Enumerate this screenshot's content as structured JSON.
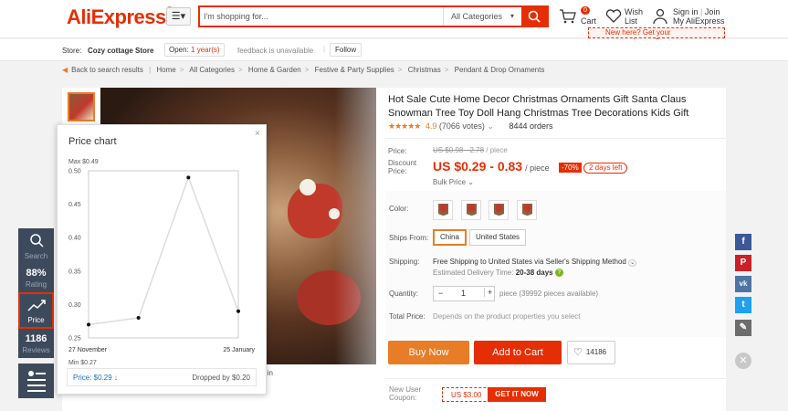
{
  "header": {
    "logo": "AliExpress",
    "logo_tm": "®",
    "search_placeholder": "I'm shopping for...",
    "search_category": "All Categories",
    "cart_count": "0",
    "cart_label": "Cart",
    "wish_label_1": "Wish",
    "wish_label_2": "List",
    "signin": "Sign in",
    "join": "Join",
    "my_aliexpress": "My AliExpress",
    "coupon_banner": "New here? Get your coupons!",
    "coupon_banner_amt": "$"
  },
  "store": {
    "label": "Store:",
    "name": "Cozy cottage Store",
    "open_label": "Open:",
    "open_value": "1 year(s)",
    "feedback": "feedback is unavailable",
    "follow": "Follow"
  },
  "breadcrumb": {
    "back": "Back to search results",
    "items": [
      "Home",
      "All Categories",
      "Home & Garden",
      "Festive & Party Supplies",
      "Christmas",
      "Pendant & Drop Ornaments"
    ]
  },
  "product": {
    "title": "Hot Sale Cute Home Decor Christmas Ornaments Gift Santa Claus Snowman Tree Toy Doll Hang Christmas Tree Decorations Kids Gift",
    "stars": "★★★★★",
    "rating": "4.9",
    "votes": "(7066 votes)",
    "orders": "8444 orders",
    "price_label": "Price:",
    "old_price": "US $0.98 - 2.78",
    "old_price_unit": "/ piece",
    "discount_label_1": "Discount",
    "discount_label_2": "Price:",
    "new_price": "US $0.29 - 0.83",
    "new_price_unit": "/ piece",
    "discount_pct": "-70%",
    "days_left": "2 days left",
    "bulk_price": "Bulk Price",
    "color_label": "Color:",
    "ships_from_label": "Ships From:",
    "ships_from_options": [
      "China",
      "United States"
    ],
    "shipping_label": "Shipping:",
    "shipping_main": "Free Shipping to United States via Seller's Shipping Method",
    "delivery_label": "Estimated Delivery Time:",
    "delivery_days": "20-38 days",
    "quantity_label": "Quantity:",
    "quantity_value": "1",
    "quantity_info": "piece (39992 pieces available)",
    "total_label": "Total Price:",
    "total_info": "Depends on the product properties you select",
    "buy_now": "Buy Now",
    "add_to_cart": "Add to Cart",
    "wish_count": "14186",
    "new_user_label_1": "New User",
    "new_user_label_2": "Coupon:",
    "coupon_amount": "US $3.00",
    "coupon_get": "GET IT NOW",
    "below_image_text": "n in"
  },
  "sidebar": {
    "search_label": "Search",
    "rating_value": "88%",
    "rating_label": "Rating",
    "price_label": "Price",
    "reviews_value": "1186",
    "reviews_label": "Reviews"
  },
  "popup": {
    "title": "Price chart",
    "close": "×",
    "current_price": "Price: $0.29 ↓",
    "dropped": "Dropped by $0.20"
  },
  "chart_data": {
    "type": "line",
    "x": [
      "",
      "",
      "",
      "",
      ""
    ],
    "xlabels": [
      "27 November",
      "25 January"
    ],
    "values": [
      0.27,
      0.28,
      0.49,
      0.29
    ],
    "ylim": [
      0.25,
      0.5
    ],
    "yticks": [
      "0.50",
      "0.45",
      "0.40",
      "0.35",
      "0.30",
      "0.25"
    ],
    "max_label": "Max $0.49",
    "min_label": "Min $0.27",
    "grid": true
  },
  "colors": {
    "brand": "#e62e04",
    "orange": "#e97c26",
    "sidebar": "#3d4a5c"
  },
  "social": [
    "f",
    "P",
    "vk",
    "t",
    "✎"
  ]
}
